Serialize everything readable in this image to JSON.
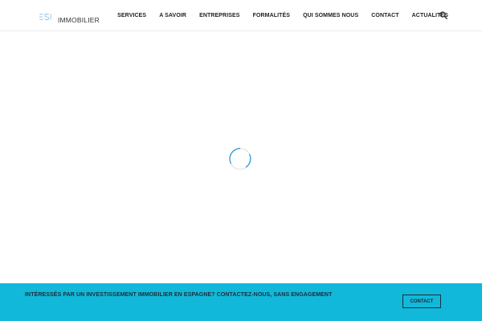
{
  "brand": {
    "logo_letters": "ESI",
    "logo_text": "IMMOBILIER",
    "logo_color": "#5aa3d6"
  },
  "nav": {
    "items": [
      {
        "label": "SERVICES"
      },
      {
        "label": "A SAVOIR"
      },
      {
        "label": "ENTREPRISES"
      },
      {
        "label": "FORMALITÉS"
      },
      {
        "label": "QUI SOMMES NOUS"
      },
      {
        "label": "CONTACT"
      },
      {
        "label": "ACTUALITÉS"
      }
    ],
    "search_icon": "search-icon"
  },
  "loader": {
    "icon": "spinner-icon",
    "color": "#3aa0d8"
  },
  "cta": {
    "text": "INTÉRESSÉS PAR UN INVESTISSEMENT IMMOBILIER EN ESPAGNE? CONTACTEZ-NOUS, SANS ENGAGEMENT",
    "button_label": "CONTACT",
    "background": "#12b8d9"
  }
}
